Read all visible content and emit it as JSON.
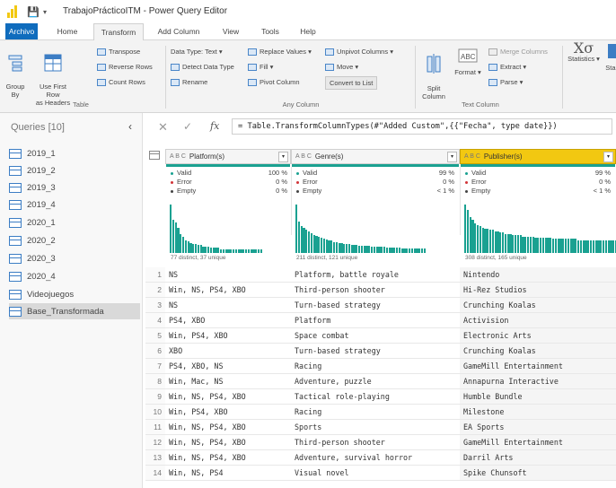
{
  "window": {
    "title": "TrabajoPrácticoITM - Power Query Editor"
  },
  "tabs": [
    "Archivo",
    "Home",
    "Transform",
    "Add Column",
    "View",
    "Tools",
    "Help"
  ],
  "active_tab": "Transform",
  "ribbon": {
    "group_by": "Group\nBy",
    "use_first_row": "Use First Row\nas Headers",
    "transpose": "Transpose",
    "reverse_rows": "Reverse Rows",
    "count_rows": "Count Rows",
    "table_label": "Table",
    "data_type": "Data Type: Text",
    "detect_data_type": "Detect Data Type",
    "rename": "Rename",
    "replace_values": "Replace Values",
    "fill": "Fill",
    "pivot_column": "Pivot Column",
    "unpivot_columns": "Unpivot Columns",
    "move": "Move",
    "convert_to_list": "Convert to List",
    "any_column_label": "Any Column",
    "split_column": "Split\nColumn",
    "format": "Format",
    "merge_columns": "Merge Columns",
    "extract": "Extract",
    "parse": "Parse",
    "text_column_label": "Text Column",
    "statistics": "Statistics",
    "standard": "Stan"
  },
  "queries": {
    "header": "Queries [10]",
    "items": [
      "2019_1",
      "2019_2",
      "2019_3",
      "2019_4",
      "2020_1",
      "2020_2",
      "2020_3",
      "2020_4",
      "Videojuegos",
      "Base_Transformada"
    ],
    "selected": "Base_Transformada"
  },
  "formula_bar": {
    "fx": "fx",
    "formula": "= Table.TransformColumnTypes(#\"Added Custom\",{{\"Fecha\", type date}})"
  },
  "columns": [
    {
      "type_icon": "A B C",
      "name": "Platform(s)",
      "valid_label": "Valid",
      "valid": "100 %",
      "error_label": "Error",
      "error": "0 %",
      "empty_label": "Empty",
      "empty": "0 %",
      "summary": "77 distinct, 37 unique",
      "distribution": [
        38,
        26,
        24,
        20,
        15,
        13,
        10,
        9,
        8,
        7,
        7,
        6,
        6,
        5,
        5,
        5,
        4,
        4,
        4,
        4,
        3,
        3,
        3,
        3,
        3,
        3,
        3,
        3,
        3,
        3,
        3,
        3,
        3,
        3,
        3,
        3,
        3
      ]
    },
    {
      "type_icon": "A B C",
      "name": "Genre(s)",
      "valid_label": "Valid",
      "valid": "99 %",
      "error_label": "Error",
      "error": "0 %",
      "empty_label": "Empty",
      "empty": "< 1 %",
      "summary": "211 distinct, 121 unique",
      "distribution": [
        52,
        34,
        29,
        27,
        25,
        23,
        21,
        19,
        18,
        17,
        16,
        15,
        14,
        13,
        13,
        12,
        12,
        11,
        11,
        10,
        10,
        10,
        9,
        9,
        9,
        8,
        8,
        8,
        8,
        8,
        7,
        7,
        7,
        7,
        7,
        7,
        6,
        6,
        6,
        6,
        6,
        6,
        5,
        5,
        5,
        5,
        5,
        5,
        5,
        5,
        5,
        5
      ]
    },
    {
      "type_icon": "A B C",
      "name": "Publisher(s)",
      "valid_label": "Valid",
      "valid": "99 %",
      "error_label": "Error",
      "error": "0 %",
      "empty_label": "Empty",
      "empty": "< 1 %",
      "summary": "308 distinct, 165 unique",
      "distribution": [
        38,
        34,
        28,
        26,
        23,
        22,
        21,
        20,
        19,
        19,
        18,
        18,
        17,
        17,
        16,
        16,
        15,
        15,
        15,
        14,
        14,
        14,
        14,
        13,
        13,
        13,
        13,
        13,
        12,
        12,
        12,
        12,
        12,
        12,
        12,
        11,
        11,
        11,
        11,
        11,
        11,
        11,
        11,
        11,
        11,
        10,
        10,
        10,
        10,
        10,
        10,
        10,
        10,
        10,
        10,
        10,
        10,
        10,
        10,
        10,
        10
      ]
    }
  ],
  "rows": [
    [
      "1",
      "NS",
      "Platform, battle royale",
      "Nintendo"
    ],
    [
      "2",
      "Win, NS, PS4, XBO",
      "Third-person shooter",
      "Hi-Rez Studios"
    ],
    [
      "3",
      "NS",
      "Turn-based strategy",
      "Crunching Koalas"
    ],
    [
      "4",
      "PS4, XBO",
      "Platform",
      "Activision"
    ],
    [
      "5",
      "Win, PS4, XBO",
      "Space combat",
      "Electronic Arts"
    ],
    [
      "6",
      "XBO",
      "Turn-based strategy",
      "Crunching Koalas"
    ],
    [
      "7",
      "PS4, XBO, NS",
      "Racing",
      "GameMill Entertainment"
    ],
    [
      "8",
      "Win, Mac, NS",
      "Adventure, puzzle",
      "Annapurna Interactive"
    ],
    [
      "9",
      "Win, NS, PS4, XBO",
      "Tactical role-playing",
      "Humble Bundle"
    ],
    [
      "10",
      "Win, PS4, XBO",
      "Racing",
      "Milestone"
    ],
    [
      "11",
      "Win, NS, PS4, XBO",
      "Sports",
      "EA Sports"
    ],
    [
      "12",
      "Win, NS, PS4, XBO",
      "Third-person shooter",
      "GameMill Entertainment"
    ],
    [
      "13",
      "Win, NS, PS4, XBO",
      "Adventure, survival horror",
      "Darril Arts"
    ],
    [
      "14",
      "Win, NS, PS4",
      "Visual novel",
      "Spike Chunsoft"
    ]
  ],
  "colors": {
    "accent": "#0f6cbd",
    "quality_bar": "#1aa191",
    "selected_header": "#f2c811",
    "valid_dot": "#1aa191",
    "error_dot": "#d13438",
    "empty_dot": "#444444"
  }
}
